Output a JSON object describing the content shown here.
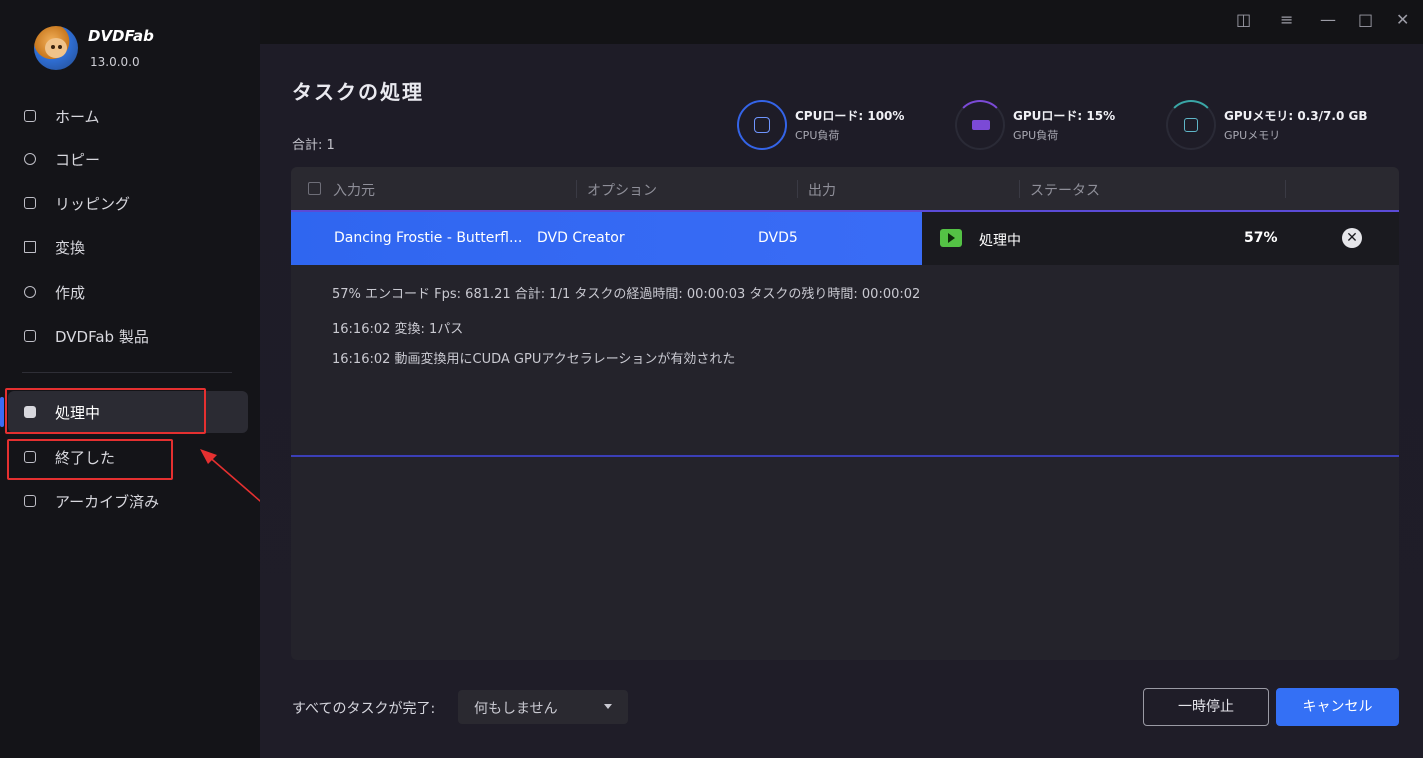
{
  "app": {
    "name": "DVDFab",
    "version": "13.0.0.0"
  },
  "sidebar": {
    "items": [
      {
        "label": "ホーム"
      },
      {
        "label": "コピー"
      },
      {
        "label": "リッピング"
      },
      {
        "label": "変換"
      },
      {
        "label": "作成"
      },
      {
        "label": "DVDFab 製品"
      }
    ],
    "task_items": [
      {
        "label": "処理中",
        "active": true
      },
      {
        "label": "終了した"
      },
      {
        "label": "アーカイブ済み"
      }
    ]
  },
  "header": {
    "title": "タスクの処理",
    "total": "合計: 1"
  },
  "meters": [
    {
      "title": "CPUロード:",
      "value": "100%",
      "subtitle": "CPU負荷"
    },
    {
      "title": "GPUロード:",
      "value": "15%",
      "subtitle": "GPU負荷"
    },
    {
      "title": "GPUメモリ:",
      "value": "0.3/7.0 GB",
      "subtitle": "GPUメモリ"
    }
  ],
  "table": {
    "columns": [
      "入力元",
      "オプション",
      "出力",
      "ステータス"
    ],
    "row": {
      "source": "Dancing Frostie - Butterfl...",
      "option": "DVD Creator",
      "output": "DVD5",
      "status": "処理中",
      "progress_text": "57%",
      "progress": 0.57
    }
  },
  "details": {
    "line1": "57%  エンコード Fps: 681.21   合計: 1/1   タスクの経過時間: 00:00:03   タスクの残り時間: 00:00:02",
    "line2": "16:16:02  変換: 1パス",
    "line3": "16:16:02  動画変換用にCUDA GPUアクセラレーションが有効された"
  },
  "footer": {
    "label": "すべてのタスクが完了:",
    "select_value": "何もしません",
    "pause_label": "一時停止",
    "cancel_label": "キャンセル"
  },
  "colors": {
    "accent": "#3470f5",
    "highlight": "#e53030",
    "status_green": "#54c245"
  }
}
